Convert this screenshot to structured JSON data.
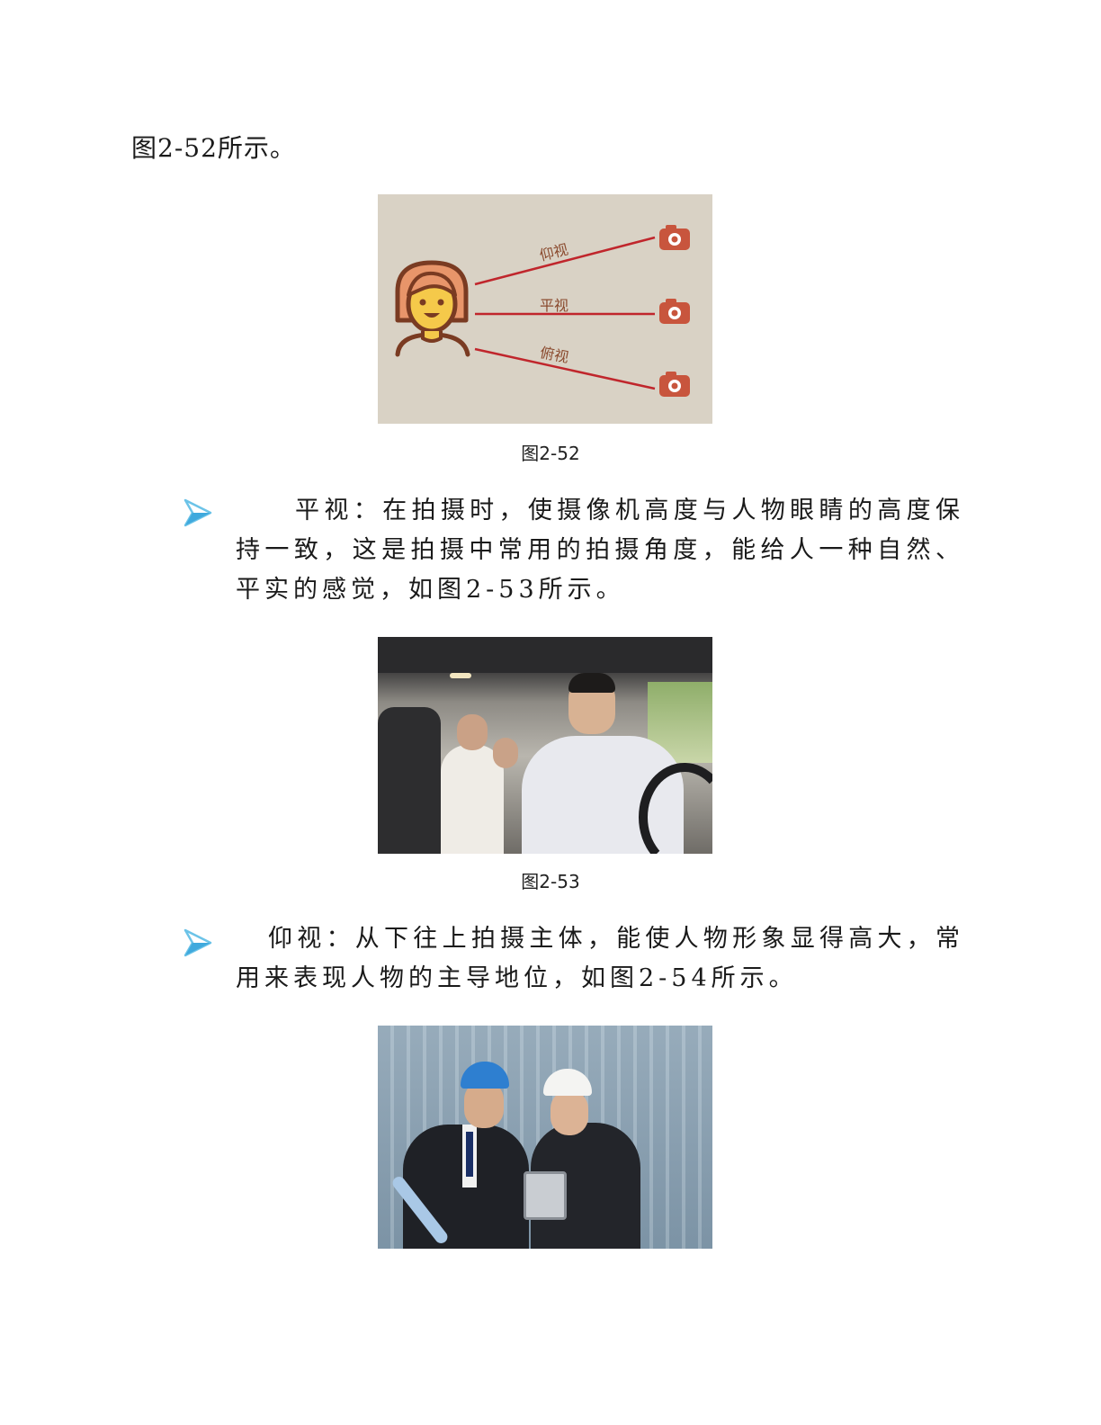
{
  "document": {
    "top_line": "图2-52所示。",
    "figure_52": {
      "caption": "图2-52",
      "labels": {
        "up": "仰视",
        "level": "平视",
        "down": "俯视"
      },
      "colors": {
        "background": "#d9d2c5",
        "line": "#c0262c",
        "camera": "#c8553d",
        "face": "#f5c94a",
        "hair": "#e8956a",
        "outline": "#7a3b22"
      }
    },
    "bullet_icon": "arrow-bullet-icon",
    "paragraph_level": "平视：在拍摄时，使摄像机高度与人物眼睛的高度保持一致，这是拍摄中常用的拍摄角度，能给人一种自然、平实的感觉，如图2-53所示。",
    "figure_53": {
      "caption": "图2-53"
    },
    "paragraph_up": "仰视：从下往上拍摄主体，能使人物形象显得高大，常用来表现人物的主导地位，如图2-54所示。"
  }
}
